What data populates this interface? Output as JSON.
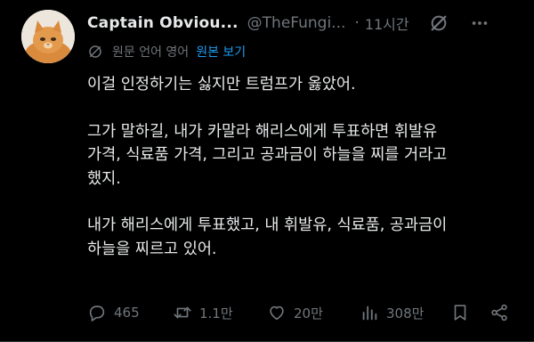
{
  "author": {
    "name": "Captain Obviou...",
    "handle": "@TheFungi...",
    "separator": "·",
    "time": "11시간"
  },
  "translation": {
    "language_note": "원문 언어 영어",
    "show_original": "원본 보기"
  },
  "post": {
    "paragraphs": [
      [
        "이걸 인정하기는 싫지만 트럼프가 옳았어."
      ],
      [
        "그가 말하길, 내가 카말라 해리스에게 투표하면 휘발유",
        "가격, 식료품 가격, 그리고 공과금이 하늘을 찌를 거라고",
        "했지."
      ],
      [
        "내가 해리스에게 투표했고, 내 휘발유, 식료품, 공과금이",
        "하늘을 찌르고 있어."
      ]
    ]
  },
  "actions": {
    "replies": "465",
    "reposts": "1.1만",
    "likes": "20만",
    "views": "308만"
  },
  "icons": [
    "grok-icon",
    "more-icon",
    "translate-icon",
    "reply-icon",
    "repost-icon",
    "like-icon",
    "views-icon",
    "bookmark-icon",
    "share-icon"
  ],
  "colors": {
    "background": "#000000",
    "text": "#e7e9ea",
    "muted": "#71767b",
    "link": "#1d9bf0"
  }
}
